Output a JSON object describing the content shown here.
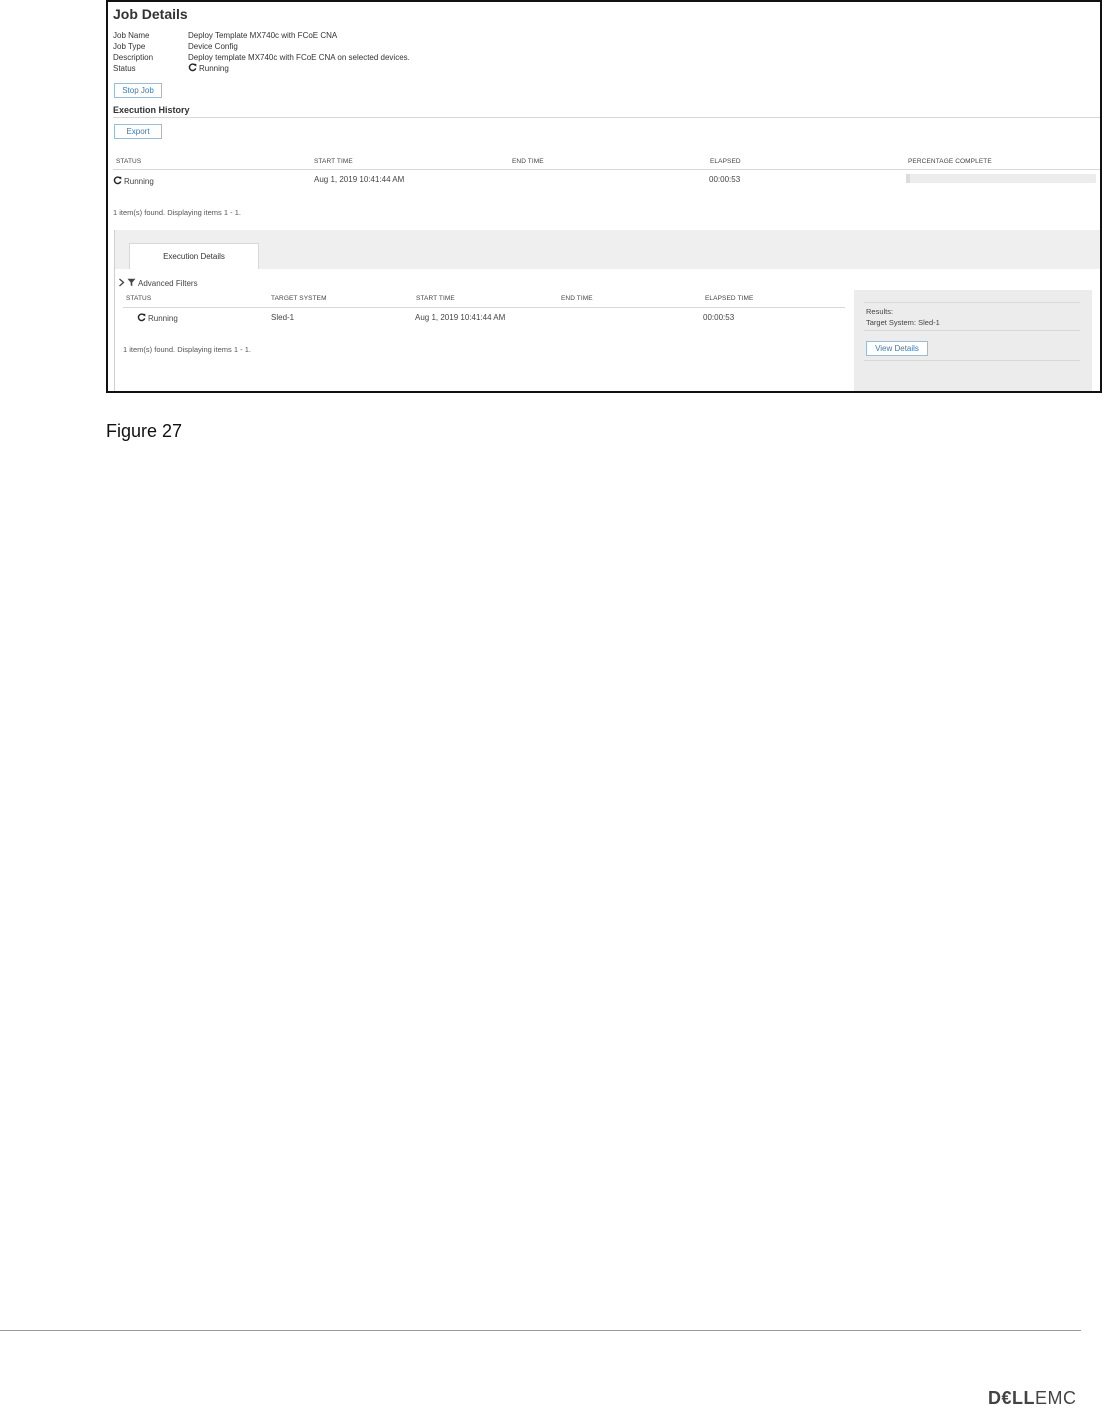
{
  "job": {
    "title": "Job Details",
    "fields": [
      {
        "label": "Job Name",
        "value": "Deploy Template MX740c with FCoE CNA"
      },
      {
        "label": "Job Type",
        "value": "Device Config"
      },
      {
        "label": "Description",
        "value": "Deploy template MX740c with FCoE CNA on selected devices."
      },
      {
        "label": "Status",
        "value": "Running"
      }
    ],
    "stop_label": "Stop Job"
  },
  "history": {
    "title": "Execution History",
    "export_label": "Export",
    "columns": [
      "STATUS",
      "START TIME",
      "END TIME",
      "ELAPSED",
      "PERCENTAGE COMPLETE"
    ],
    "row": {
      "status": "Running",
      "start": "Aug 1, 2019 10:41:44 AM",
      "end": "",
      "elapsed": "00:00:53",
      "percent_complete": 0.02
    },
    "footer": "1 item(s) found. Displaying items 1 - 1."
  },
  "details": {
    "tab_label": "Execution Details",
    "filters_label": "Advanced Filters",
    "columns": [
      "STATUS",
      "TARGET SYSTEM",
      "START TIME",
      "END TIME",
      "ELAPSED TIME"
    ],
    "row": {
      "status": "Running",
      "target": "Sled-1",
      "start": "Aug 1, 2019 10:41:44 AM",
      "end": "",
      "elapsed": "00:00:53"
    },
    "footer": "1 item(s) found. Displaying items 1 - 1.",
    "results_label": "Results:",
    "results_target": "Target System: Sled-1",
    "view_label": "View Details"
  },
  "caption": "Figure 27",
  "logo": {
    "dell": "D€LL",
    "emc": "EMC"
  },
  "icons": {
    "status": "refresh-icon",
    "expand": "chevron-right-icon",
    "filter": "funnel-icon"
  }
}
